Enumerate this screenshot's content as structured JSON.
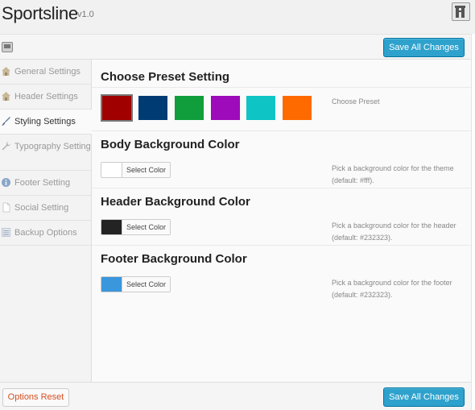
{
  "app": {
    "title": "Sportsline",
    "version": "v1.0"
  },
  "toolbar": {
    "save_label": "Save All Changes"
  },
  "footer": {
    "reset_label": "Options Reset",
    "save_label": "Save All Changes"
  },
  "sidebar": {
    "items": [
      {
        "label": "General Settings",
        "icon": "house-icon",
        "active": false
      },
      {
        "label": "Header Settings",
        "icon": "house-icon",
        "active": false
      },
      {
        "label": "Styling Settings",
        "icon": "paintbrush-icon",
        "active": true
      },
      {
        "label": "Typography Setting",
        "icon": "wrench-icon",
        "active": false
      },
      {
        "label": "Footer Setting",
        "icon": "info-icon",
        "active": false
      },
      {
        "label": "Social Setting",
        "icon": "page-icon",
        "active": false
      },
      {
        "label": "Backup Options",
        "icon": "list-icon",
        "active": false
      }
    ]
  },
  "sections": {
    "preset": {
      "heading": "Choose Preset Setting",
      "description": "Choose Preset",
      "swatches": [
        "#a00000",
        "#003b73",
        "#0f9e3b",
        "#9d0bba",
        "#0ec4c4",
        "#ff6a00"
      ],
      "selected_index": 0
    },
    "body_bg": {
      "heading": "Body Background Color",
      "button_label": "Select Color",
      "color": "#ffffff",
      "description_line1": "Pick a background color for the theme",
      "description_line2": "(default: #fff)."
    },
    "header_bg": {
      "heading": "Header Background Color",
      "button_label": "Select Color",
      "color": "#232323",
      "description_line1": "Pick a background color for the header",
      "description_line2": "(default: #232323)."
    },
    "footer_bg": {
      "heading": "Footer Background Color",
      "button_label": "Select Color",
      "color": "#3a97dc",
      "description_line1": "Pick a background color for the footer",
      "description_line2": "(default: #232323)."
    }
  },
  "colors": {
    "primary_button": "#2ea2cc",
    "reset_text": "#d54e21"
  }
}
